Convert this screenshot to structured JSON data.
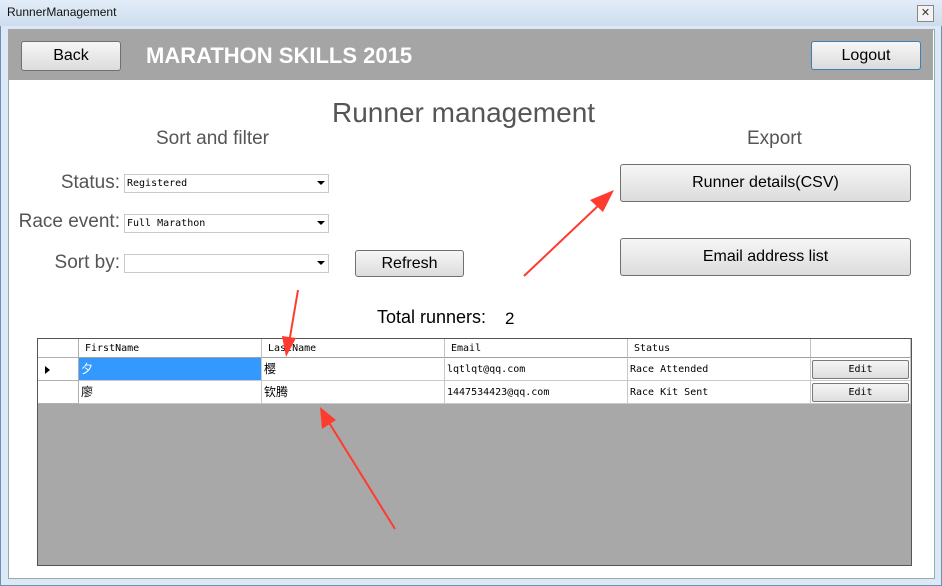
{
  "window": {
    "title": "RunnerManagement",
    "close_glyph": "✕"
  },
  "header": {
    "back_label": "Back",
    "app_title": "MARATHON SKILLS 2015",
    "logout_label": "Logout"
  },
  "page": {
    "title": "Runner management"
  },
  "sort_filter": {
    "title": "Sort and filter",
    "status_label": "Status:",
    "status_value": "Registered",
    "race_label": "Race event:",
    "race_value": "Full Marathon",
    "sortby_label": "Sort by:",
    "sortby_value": "",
    "refresh_label": "Refresh"
  },
  "export": {
    "title": "Export",
    "csv_label": "Runner details(CSV)",
    "email_label": "Email address list"
  },
  "summary": {
    "total_label": "Total runners:",
    "total_value": "2"
  },
  "grid": {
    "columns": [
      "FirstName",
      "LastName",
      "Email",
      "Status",
      ""
    ],
    "rows": [
      {
        "first": "夕",
        "last": "樱",
        "email": "lqtlqt@qq.com",
        "status": "Race Attended",
        "action": "Edit"
      },
      {
        "first": "廖",
        "last": "钦腾",
        "email": "1447534423@qq.com",
        "status": "Race Kit Sent",
        "action": "Edit"
      }
    ]
  },
  "annotations": {
    "arrow_color": "#ff3b30"
  }
}
